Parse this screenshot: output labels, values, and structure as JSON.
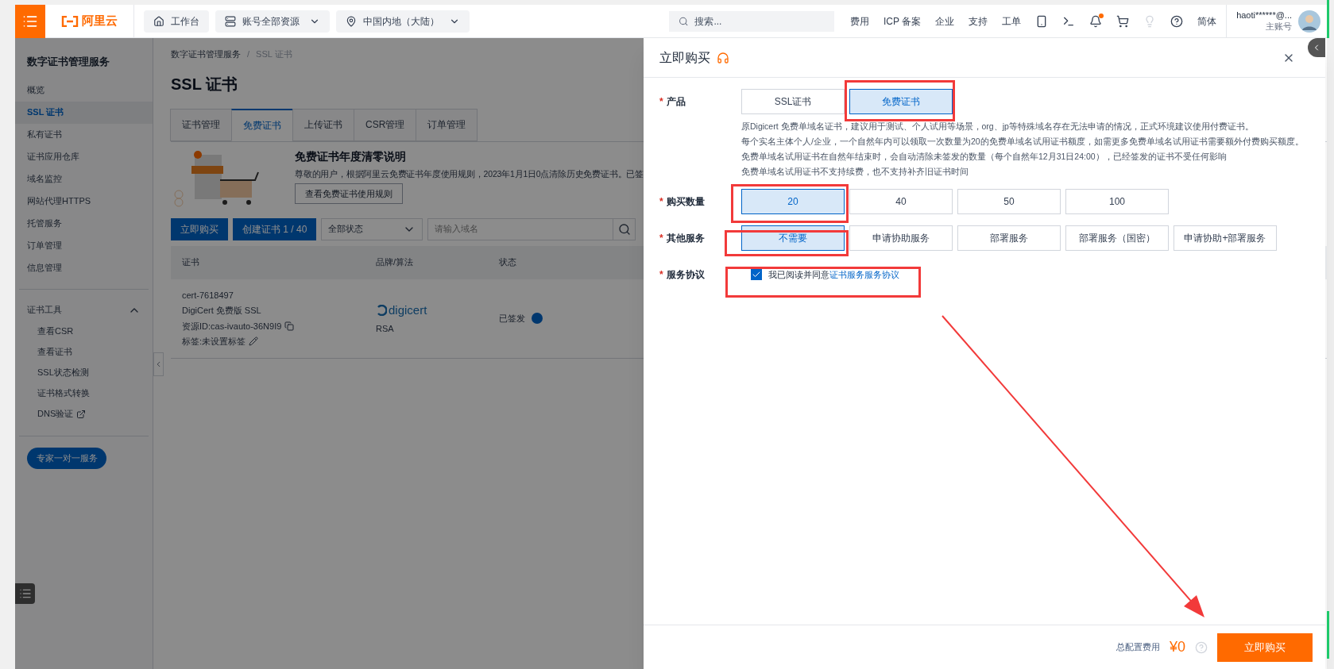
{
  "topbar": {
    "logo": "阿里云",
    "nav": [
      {
        "kind": "home",
        "label": "工作台"
      },
      {
        "kind": "resources",
        "label": "账号全部资源"
      },
      {
        "kind": "region",
        "label": "中国内地（大陆）"
      }
    ],
    "search": {
      "placeholder": "搜索..."
    },
    "links": [
      "费用",
      "ICP 备案",
      "企业",
      "支持",
      "工单"
    ],
    "language": "简体",
    "user": {
      "name": "haoti******@...",
      "role": "主账号"
    }
  },
  "sidebar": {
    "title": "数字证书管理服务",
    "items": [
      {
        "label": "概览",
        "selected": false
      },
      {
        "label": "SSL 证书",
        "selected": true
      },
      {
        "label": "私有证书",
        "selected": false
      },
      {
        "label": "证书应用仓库",
        "selected": false
      },
      {
        "label": "域名监控",
        "selected": false
      },
      {
        "label": "网站代理HTTPS",
        "selected": false
      },
      {
        "label": "托管服务",
        "selected": false
      },
      {
        "label": "订单管理",
        "selected": false
      },
      {
        "label": "信息管理",
        "selected": false
      }
    ],
    "group": {
      "label": "证书工具",
      "expanded": true,
      "children": [
        {
          "label": "查看CSR",
          "kind": "link"
        },
        {
          "label": "查看证书",
          "kind": "link"
        },
        {
          "label": "SSL状态检测",
          "kind": "link"
        },
        {
          "label": "证书格式转换",
          "kind": "link"
        },
        {
          "label": "DNS验证",
          "kind": "external"
        }
      ]
    },
    "expert_button": "专家一对一服务"
  },
  "main": {
    "breadcrumb": [
      "数字证书管理服务",
      "SSL 证书"
    ],
    "breadcrumb_separator": "/",
    "title": "SSL 证书",
    "tabs": [
      {
        "label": "证书管理",
        "selected": false
      },
      {
        "label": "免费证书",
        "selected": true
      },
      {
        "label": "上传证书",
        "selected": false
      },
      {
        "label": "CSR管理",
        "selected": false
      },
      {
        "label": "订单管理",
        "selected": false
      }
    ],
    "notice": {
      "title": "免费证书年度清零说明",
      "text": "尊敬的用户，根据阿里云免费证书年度使用规则，2023年1月1日0点清除历史免费证书。已签",
      "button": "查看免费证书使用规则"
    },
    "toolbar": {
      "buy": "立即购买",
      "create": "创建证书 1 / 40",
      "status_filter": "全部状态",
      "search_placeholder": "请输入域名"
    },
    "table": {
      "columns": [
        "证书",
        "品牌/算法",
        "状态"
      ],
      "rows": [
        {
          "name": "cert-7618497",
          "product": "DigiCert 免费版 SSL",
          "resource_id": "资源ID:cas-ivauto-36N9I9",
          "tags": "标签:未设置标签",
          "brand": "digicert",
          "algorithm": "RSA",
          "status": "已签发"
        }
      ]
    }
  },
  "drawer": {
    "title": "立即购买",
    "fields": [
      {
        "kind": "options",
        "required_mark": "*",
        "label": "产品",
        "options": [
          {
            "label": "SSL证书",
            "selected": false
          },
          {
            "label": "免费证书",
            "selected": true
          }
        ],
        "notes": [
          "原Digicert 免费单域名证书，建议用于测试、个人试用等场景，org、jp等特殊域名存在无法申请的情况，正式环境建议使用付费证书。",
          "每个实名主体个人/企业，一个自然年内可以领取一次数量为20的免费单域名试用证书额度，如需更多免费单域名试用证书需要额外付费购买额度。",
          "免费单域名试用证书在自然年结束时，会自动清除未签发的数量（每个自然年12月31日24:00），已经签发的证书不受任何影响",
          "免费单域名试用证书不支持续费，也不支持补齐旧证书时间"
        ]
      },
      {
        "kind": "options",
        "required_mark": "*",
        "label": "购买数量",
        "options": [
          {
            "label": "20",
            "selected": true
          },
          {
            "label": "40",
            "selected": false
          },
          {
            "label": "50",
            "selected": false
          },
          {
            "label": "100",
            "selected": false
          }
        ]
      },
      {
        "kind": "options",
        "required_mark": "*",
        "label": "其他服务",
        "options": [
          {
            "label": "不需要",
            "selected": true
          },
          {
            "label": "申请协助服务",
            "selected": false
          },
          {
            "label": "部署服务",
            "selected": false
          },
          {
            "label": "部署服务（国密）",
            "selected": false
          },
          {
            "label": "申请协助+部署服务",
            "selected": false
          }
        ]
      },
      {
        "kind": "checkbox",
        "required_mark": "*",
        "label": "服务协议",
        "checked": true,
        "text": "我已阅读并同意",
        "link": "证书服务服务协议"
      }
    ],
    "footer": {
      "cost_label": "总配置费用",
      "price": "¥0",
      "button": "立即购买"
    }
  }
}
